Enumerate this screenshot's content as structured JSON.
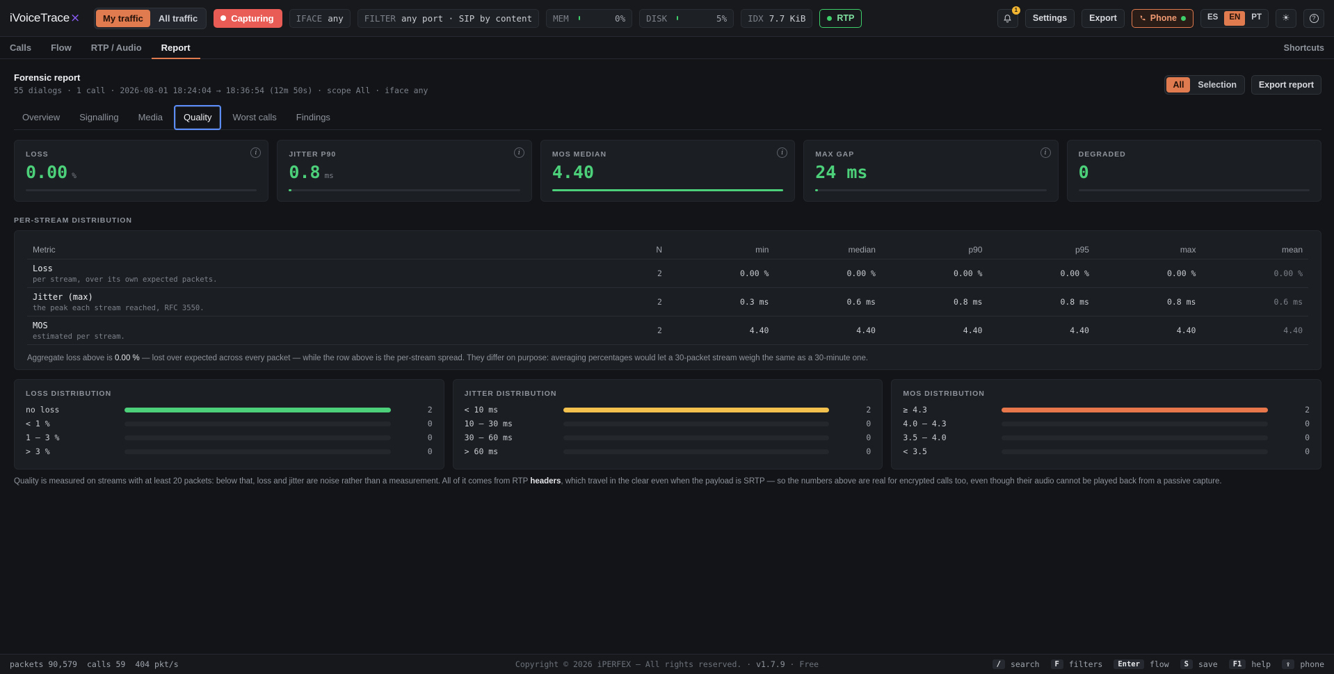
{
  "app": {
    "brand": "iVoiceTrace",
    "brand_mark": "⨯",
    "traffic_mode": [
      "My traffic",
      "All traffic"
    ],
    "capture_label": "Capturing",
    "iface": {
      "key": "IFACE",
      "value": "any"
    },
    "filter": {
      "key": "FILTER",
      "value": "any port · SIP by content"
    },
    "mem": {
      "key": "MEM",
      "pct": "0%",
      "level": 0
    },
    "disk": {
      "key": "DISK",
      "pct": "5%",
      "level": 0.05
    },
    "idx": {
      "key": "IDX",
      "value": "7.7 KiB"
    },
    "rtp_label": "RTP",
    "notification_count": "1",
    "settings_label": "Settings",
    "export_label": "Export",
    "phone_label": "Phone",
    "languages": [
      "ES",
      "EN",
      "PT"
    ],
    "active_language": "EN",
    "theme_icon": "☀",
    "help_icon": "?"
  },
  "nav": {
    "tabs": [
      "Calls",
      "Flow",
      "RTP / Audio",
      "Report"
    ],
    "active": "Report",
    "shortcuts_label": "Shortcuts"
  },
  "report": {
    "title": "Forensic report",
    "subtitle": "55 dialogs · 1 call · 2026-08-01 18:24:04 → 18:36:54 (12m 50s) · scope All · iface any",
    "scope": [
      "All",
      "Selection"
    ],
    "export_label": "Export report",
    "subtabs": [
      "Overview",
      "Signalling",
      "Media",
      "Quality",
      "Worst calls",
      "Findings"
    ],
    "active_subtab": "Quality"
  },
  "kpis": [
    {
      "label": "LOSS",
      "value": "0.00",
      "unit": "%",
      "level": 0,
      "info": true,
      "color": "#4cd07a"
    },
    {
      "label": "JITTER P90",
      "value": "0.8",
      "unit": "ms",
      "level": 0.01,
      "info": true,
      "color": "#4cd07a"
    },
    {
      "label": "MOS MEDIAN",
      "value": "4.40",
      "unit": "",
      "level": 1,
      "info": true,
      "color": "#4cd07a"
    },
    {
      "label": "MAX GAP",
      "value": "24 ms",
      "unit": "",
      "level": 0.01,
      "info": true,
      "color": "#4cd07a"
    },
    {
      "label": "DEGRADED",
      "value": "0",
      "unit": "",
      "level": 0,
      "info": false,
      "color": "#4cd07a"
    }
  ],
  "distribution": {
    "section_title": "PER-STREAM DISTRIBUTION",
    "columns": [
      "Metric",
      "N",
      "min",
      "median",
      "p90",
      "p95",
      "max",
      "mean"
    ],
    "rows": [
      {
        "name": "Loss",
        "desc": "per stream, over its own expected packets.",
        "n": "2",
        "min": "0.00 %",
        "median": "0.00 %",
        "p90": "0.00 %",
        "p95": "0.00 %",
        "max": "0.00 %",
        "mean": "0.00 %"
      },
      {
        "name": "Jitter (max)",
        "desc": "the peak each stream reached, RFC 3550.",
        "n": "2",
        "min": "0.3 ms",
        "median": "0.6 ms",
        "p90": "0.8 ms",
        "p95": "0.8 ms",
        "max": "0.8 ms",
        "mean": "0.6 ms"
      },
      {
        "name": "MOS",
        "desc": "estimated per stream.",
        "n": "2",
        "min": "4.40",
        "median": "4.40",
        "p90": "4.40",
        "p95": "4.40",
        "max": "4.40",
        "mean": "4.40"
      }
    ],
    "note_prefix": "Aggregate loss above is ",
    "note_value": "0.00 %",
    "note_suffix": " — lost over expected across every packet — while the row above is the per-stream spread. They differ on purpose: averaging percentages would let a 30-packet stream weigh the same as a 30-minute one."
  },
  "buckets": [
    {
      "title": "LOSS DISTRIBUTION",
      "color": "#4cd07a",
      "rows": [
        {
          "label": "no loss",
          "count": "2",
          "fraction": 1
        },
        {
          "label": "< 1 %",
          "count": "0",
          "fraction": 0
        },
        {
          "label": "1 – 3 %",
          "count": "0",
          "fraction": 0
        },
        {
          "label": "> 3 %",
          "count": "0",
          "fraction": 0
        }
      ]
    },
    {
      "title": "JITTER DISTRIBUTION",
      "color": "#f2c14e",
      "rows": [
        {
          "label": "< 10 ms",
          "count": "2",
          "fraction": 1
        },
        {
          "label": "10 – 30 ms",
          "count": "0",
          "fraction": 0
        },
        {
          "label": "30 – 60 ms",
          "count": "0",
          "fraction": 0
        },
        {
          "label": "> 60 ms",
          "count": "0",
          "fraction": 0
        }
      ]
    },
    {
      "title": "MOS DISTRIBUTION",
      "color": "#e8774c",
      "rows": [
        {
          "label": "≥ 4.3",
          "count": "2",
          "fraction": 1
        },
        {
          "label": "4.0 – 4.3",
          "count": "0",
          "fraction": 0
        },
        {
          "label": "3.5 – 4.0",
          "count": "0",
          "fraction": 0
        },
        {
          "label": "< 3.5",
          "count": "0",
          "fraction": 0
        }
      ]
    }
  ],
  "quality_note": {
    "prefix": "Quality is measured on streams with at least 20 packets: below that, loss and jitter are noise rather than a measurement. All of it comes from RTP ",
    "bold": "headers",
    "suffix": ", which travel in the clear even when the payload is SRTP — so the numbers above are real for encrypted calls too, even though their audio cannot be played back from a passive capture."
  },
  "status": {
    "packets": "packets 90,579",
    "calls": "calls 59",
    "rate": "404 pkt/s",
    "copyright": "Copyright © 2026 iPERFEX — All rights reserved. · ",
    "version": "v1.7.9",
    "plan": " · Free",
    "keys": [
      {
        "key": "/",
        "label": "search"
      },
      {
        "key": "F",
        "label": "filters"
      },
      {
        "key": "Enter",
        "label": "flow"
      },
      {
        "key": "S",
        "label": "save"
      },
      {
        "key": "F1",
        "label": "help"
      },
      {
        "key": "⇪",
        "label": "phone"
      }
    ]
  }
}
